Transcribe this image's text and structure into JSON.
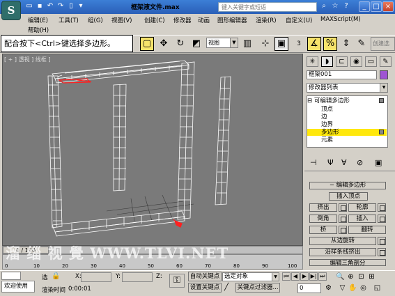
{
  "titlebar": {
    "logo": "S",
    "doc_title": "框架液文件.max",
    "search_placeholder": "键入关键字或短语",
    "quick_icons": [
      "open-icon",
      "save-icon",
      "undo-icon",
      "redo-icon",
      "file-icon"
    ],
    "window_buttons": [
      "_",
      "□",
      "×"
    ]
  },
  "menus": [
    "编辑(E)",
    "工具(T)",
    "组(G)",
    "视图(V)",
    "创建(C)",
    "修改器",
    "动画",
    "图形编辑器",
    "渲染(R)",
    "自定义(U)",
    "MAXScript(M)",
    "帮助(H)"
  ],
  "instruction": "配合按下<Ctrl>键选择多边形。",
  "toolbar": {
    "viewport_dropdown": "视图",
    "selection_set": "创建选",
    "angle_snap_label": "3"
  },
  "viewport": {
    "label": "[ + ] 透视 ] 线框 ]",
    "bg_color": "#7a7a7a",
    "wire_color": "#ffffff",
    "selected_color": "#ff2020"
  },
  "timeslider": {
    "frame_display": "0 / 100"
  },
  "ruler": {
    "ticks": [
      "0",
      "10",
      "20",
      "30",
      "40",
      "50",
      "60",
      "70",
      "80",
      "90",
      "100"
    ]
  },
  "watermark": "溜 缁 视 覺 WWW.TLVI.NET",
  "status": {
    "welcome": "欢迎使用",
    "selected_label": "选",
    "render_time_label": "渲染时间",
    "render_time_value": "0:00:01",
    "x_label": "X:",
    "y_label": "Y:",
    "z_label": "Z:",
    "auto_key": "自动关键点",
    "set_key": "设置关键点",
    "selected_object": "选定对象",
    "key_filters": "关键点过滤器...",
    "frame_value": "0"
  },
  "panel": {
    "tabs": [
      "create-tab",
      "modify-tab",
      "hierarchy-tab",
      "motion-tab",
      "display-tab",
      "utilities-tab"
    ],
    "object_name": "框架001",
    "object_color": "#9f54d3",
    "modifier_list": "修改器列表",
    "stack": {
      "root": "可编辑多边形",
      "items": [
        "顶点",
        "边",
        "边界",
        "多边形",
        "元素"
      ],
      "selected_index": 3
    },
    "rollout_title": "编辑多边形",
    "buttons": {
      "insert_vertex": "插入顶点",
      "extrude": "挤出",
      "outline": "轮廓",
      "bevel": "倒角",
      "inset": "插入",
      "bridge": "桥",
      "flip": "翻转",
      "hinge_from_edge": "从边旋转",
      "extrude_along_spline": "沿样条线挤出",
      "edit_triangulation": "编辑三角剖分"
    }
  }
}
